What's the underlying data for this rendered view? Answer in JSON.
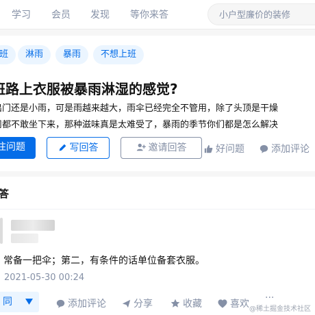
{
  "nav": {
    "items": [
      "学习",
      "会员",
      "发现",
      "等你来答"
    ],
    "search_placeholder": "小户型廉价的装修"
  },
  "question": {
    "tags": [
      "班",
      "淋雨",
      "暴雨",
      "不想上班"
    ],
    "title": "班路上衣服被暴雨淋湿的感觉?",
    "description": [
      "出门还是小雨，可是雨越来越大，雨伞已经完全不管用，除了头顶是干燥",
      "司都不敢坐下来，那种滋味真是太难受了，暴雨的季节你们都是怎么解决"
    ],
    "actions": {
      "follow": "注问题",
      "write": "写回答",
      "invite": "邀请回答",
      "good": "好问题",
      "comment": "添加评论"
    }
  },
  "answer": {
    "header": "答",
    "content": "常备一把伞；第二，有条件的话单位备套衣服。",
    "date": "2021-05-30 00:24",
    "vote_label": "同",
    "actions": {
      "comment": "添加评论",
      "share": "分享",
      "favorite": "收藏",
      "like": "喜欢",
      "more": "···"
    },
    "watermark": "@稀土掘金技术社区"
  },
  "colors": {
    "accent": "#056de8",
    "muted": "#8590a6",
    "tag_bg": "#ebf5ff"
  }
}
